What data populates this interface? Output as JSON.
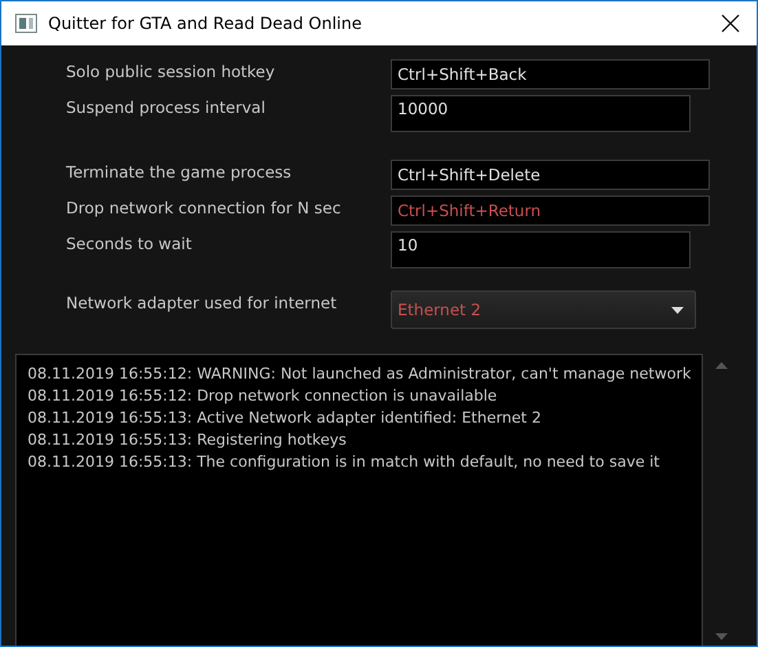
{
  "window": {
    "title": "Quitter for GTA and Read Dead Online"
  },
  "setting_groups": [
    [
      {
        "kind": "hotkey",
        "label": "Solo public session hotkey",
        "value": "Ctrl+Shift+Back",
        "invalid": false
      },
      {
        "kind": "number",
        "label": "Suspend process interval",
        "value": "10000",
        "invalid": false
      }
    ],
    [
      {
        "kind": "hotkey",
        "label": "Terminate the game process",
        "value": "Ctrl+Shift+Delete",
        "invalid": false
      },
      {
        "kind": "hotkey",
        "label": "Drop network connection for N sec",
        "value": "Ctrl+Shift+Return",
        "invalid": true
      },
      {
        "kind": "number",
        "label": "Seconds to wait",
        "value": "10",
        "invalid": false
      },
      {
        "kind": "dropdown",
        "label": "Network adapter used for internet",
        "value": "Ethernet 2",
        "invalid": true
      }
    ]
  ],
  "log": [
    "08.11.2019 16:55:12: WARNING: Not launched as Administrator, can't manage network",
    "08.11.2019 16:55:12: Drop network connection is unavailable",
    "08.11.2019 16:55:13: Active Network adapter identified: Ethernet 2",
    "08.11.2019 16:55:13: Registering hotkeys",
    "08.11.2019 16:55:13: The configuration is in match with default, no need to save it"
  ]
}
